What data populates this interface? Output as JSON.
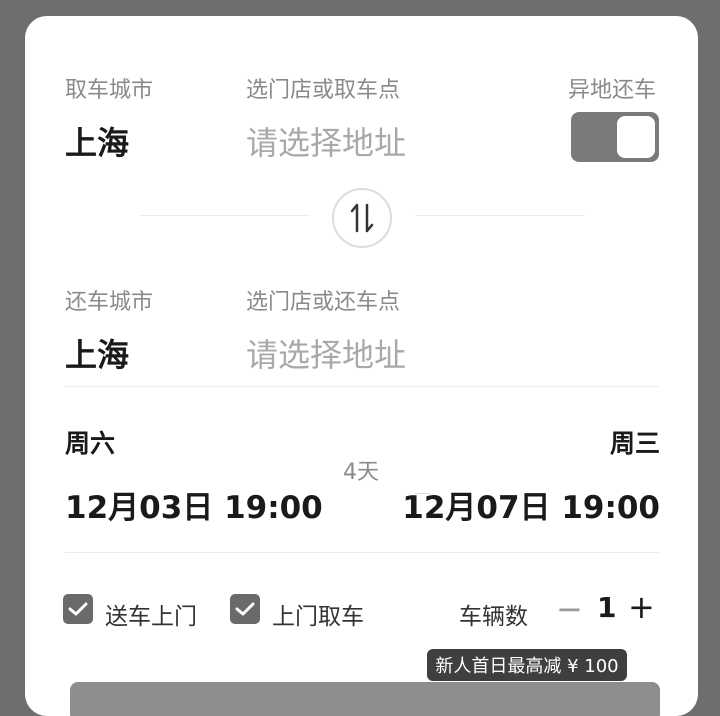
{
  "pickup": {
    "city_label": "取车城市",
    "city": "上海",
    "store_label": "选门店或取车点",
    "address_placeholder": "请选择地址",
    "diff_return_label": "异地还车"
  },
  "return": {
    "city_label": "还车城市",
    "city": "上海",
    "store_label": "选门店或还车点",
    "address_placeholder": "请选择地址"
  },
  "dates": {
    "start_day": "周六",
    "start_datetime": "12月03日 19:00",
    "duration": "4天",
    "end_day": "周三",
    "end_datetime": "12月07日 19:00"
  },
  "options": {
    "delivery_label": "送车上门",
    "pickup_service_label": "上门取车",
    "vehicle_count_label": "车辆数",
    "minus": "−",
    "count": "1",
    "plus": "+"
  },
  "promo": {
    "text": "新人首日最高减 ¥ 100"
  },
  "colors": {
    "accent": "#6a6a6a",
    "toggle_bg": "#7a7a7a",
    "page_bg": "#6e6e6e"
  },
  "icons": {
    "swap": "swap-vertical-icon",
    "check": "checkmark-icon"
  }
}
